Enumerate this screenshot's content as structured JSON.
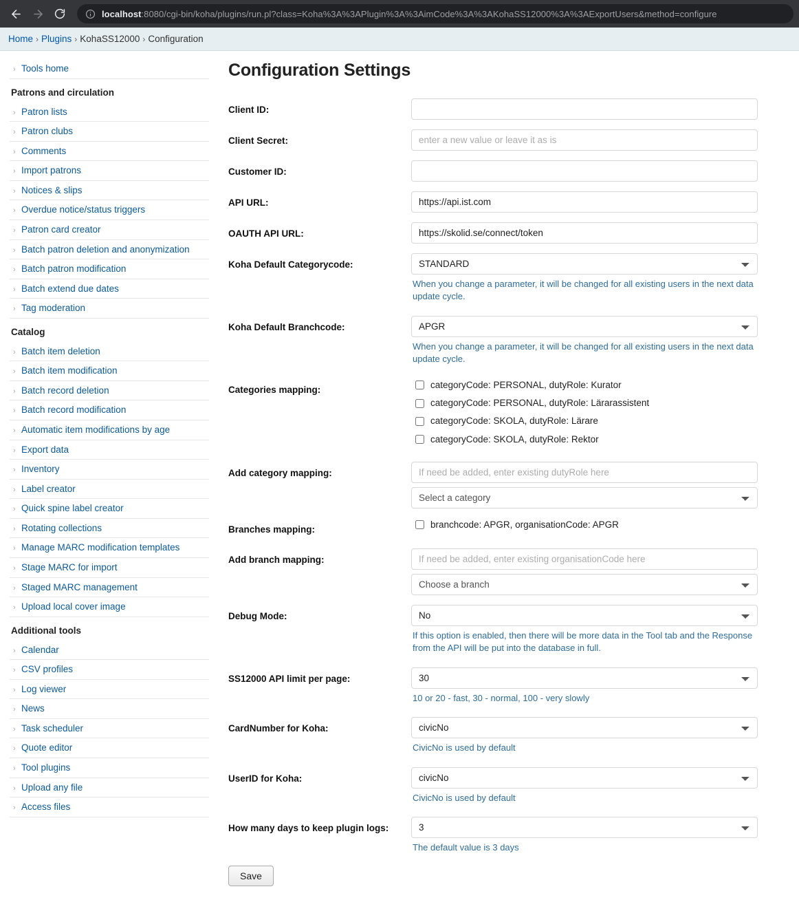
{
  "browser": {
    "back_icon": "back-arrow-icon",
    "forward_icon": "forward-arrow-icon",
    "reload_icon": "reload-icon",
    "info_icon": "info-circle-icon",
    "url_host": "localhost",
    "url_rest": ":8080/cgi-bin/koha/plugins/run.pl?class=Koha%3A%3APlugin%3A%3AimCode%3A%3AKohaSS12000%3A%3AExportUsers&method=configure"
  },
  "breadcrumb": {
    "items": [
      {
        "label": "Home",
        "link": true
      },
      {
        "label": "Plugins",
        "link": true
      },
      {
        "label": "KohaSS12000",
        "link": false
      },
      {
        "label": "Configuration",
        "link": false
      }
    ],
    "separator": "›"
  },
  "sidebar": {
    "chevron": "›",
    "top_link": "Tools home",
    "groups": [
      {
        "title": "Patrons and circulation",
        "items": [
          "Patron lists",
          "Patron clubs",
          "Comments",
          "Import patrons",
          "Notices & slips",
          "Overdue notice/status triggers",
          "Patron card creator",
          "Batch patron deletion and anonymization",
          "Batch patron modification",
          "Batch extend due dates",
          "Tag moderation"
        ]
      },
      {
        "title": "Catalog",
        "items": [
          "Batch item deletion",
          "Batch item modification",
          "Batch record deletion",
          "Batch record modification",
          "Automatic item modifications by age",
          "Export data",
          "Inventory",
          "Label creator",
          "Quick spine label creator",
          "Rotating collections",
          "Manage MARC modification templates",
          "Stage MARC for import",
          "Staged MARC management",
          "Upload local cover image"
        ]
      },
      {
        "title": "Additional tools",
        "items": [
          "Calendar",
          "CSV profiles",
          "Log viewer",
          "News",
          "Task scheduler",
          "Quote editor",
          "Tool plugins",
          "Upload any file",
          "Access files"
        ]
      }
    ]
  },
  "main": {
    "title": "Configuration Settings",
    "fields": {
      "client_id": {
        "label": "Client ID:",
        "value": "",
        "placeholder": ""
      },
      "client_secret": {
        "label": "Client Secret:",
        "value": "",
        "placeholder": "enter a new value or leave it as is"
      },
      "customer_id": {
        "label": "Customer ID:",
        "value": "",
        "placeholder": ""
      },
      "api_url": {
        "label": "API URL:",
        "value": "https://api.ist.com",
        "placeholder": ""
      },
      "oauth_api_url": {
        "label": "OAUTH API URL:",
        "value": "https://skolid.se/connect/token",
        "placeholder": ""
      },
      "default_categorycode": {
        "label": "Koha Default Categorycode:",
        "value": "STANDARD",
        "hint": "When you change a parameter, it will be changed for all existing users in the next data update cycle."
      },
      "default_branchcode": {
        "label": "Koha Default Branchcode:",
        "value": "APGR",
        "hint": "When you change a parameter, it will be changed for all existing users in the next data update cycle."
      },
      "categories_mapping": {
        "label": "Categories mapping:",
        "options": [
          {
            "label": "categoryCode: PERSONAL, dutyRole: Kurator",
            "checked": false
          },
          {
            "label": "categoryCode: PERSONAL, dutyRole: Lärarassistent",
            "checked": false
          },
          {
            "label": "categoryCode: SKOLA, dutyRole: Lärare",
            "checked": false
          },
          {
            "label": "categoryCode: SKOLA, dutyRole: Rektor",
            "checked": false
          }
        ]
      },
      "add_category_mapping": {
        "label": "Add category mapping:",
        "text_value": "",
        "text_placeholder": "If need be added, enter existing dutyRole here",
        "select_value": "Select a category"
      },
      "branches_mapping": {
        "label": "Branches mapping:",
        "options": [
          {
            "label": "branchcode: APGR, organisationCode: APGR",
            "checked": false
          }
        ]
      },
      "add_branch_mapping": {
        "label": "Add branch mapping:",
        "text_value": "",
        "text_placeholder": "If need be added, enter existing organisationCode here",
        "select_value": "Choose a branch"
      },
      "debug_mode": {
        "label": "Debug Mode:",
        "value": "No",
        "hint": "If this option is enabled, then there will be more data in the Tool tab and the Response from the API will be put into the database in full."
      },
      "api_limit": {
        "label": "SS12000 API limit per page:",
        "value": "30",
        "hint": "10 or 20 - fast, 30 - normal, 100 - very slowly"
      },
      "cardnumber": {
        "label": "CardNumber for Koha:",
        "value": "civicNo",
        "hint": "CivicNo is used by default"
      },
      "userid": {
        "label": "UserID for Koha:",
        "value": "civicNo",
        "hint": "CivicNo is used by default"
      },
      "log_days": {
        "label": "How many days to keep plugin logs:",
        "value": "3",
        "hint": "The default value is 3 days"
      }
    },
    "save_label": "Save"
  }
}
